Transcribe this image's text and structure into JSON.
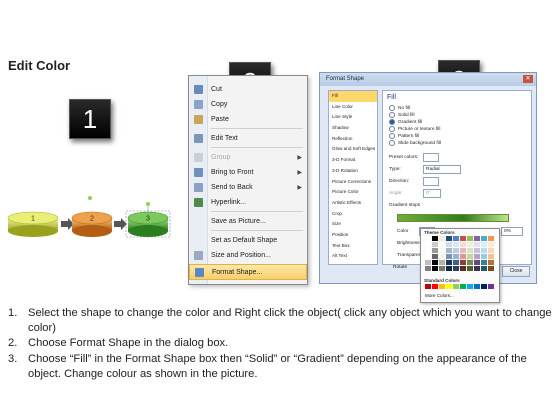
{
  "title": "Edit Color",
  "badges": [
    "1",
    "2",
    "3"
  ],
  "diagram": {
    "shapes": [
      {
        "label": "1",
        "color": "#d6df3a"
      },
      {
        "label": "2",
        "color": "#e0892c"
      },
      {
        "label": "3",
        "color": "#4fae3c"
      }
    ],
    "arrow_color": "#555555"
  },
  "context_menu": {
    "items": [
      {
        "label": "Cut",
        "icon": "scissors-icon",
        "disabled": false,
        "submenu": false
      },
      {
        "label": "Copy",
        "icon": "copy-icon",
        "disabled": false,
        "submenu": false
      },
      {
        "label": "Paste",
        "icon": "paste-icon",
        "disabled": false,
        "submenu": false
      },
      {
        "label": "Edit Text",
        "icon": "edit-text-icon",
        "disabled": false,
        "submenu": false
      },
      {
        "label": "Group",
        "icon": "group-icon",
        "disabled": true,
        "submenu": true
      },
      {
        "label": "Bring to Front",
        "icon": "bring-front-icon",
        "disabled": false,
        "submenu": true
      },
      {
        "label": "Send to Back",
        "icon": "send-back-icon",
        "disabled": false,
        "submenu": true
      },
      {
        "label": "Hyperlink...",
        "icon": "hyperlink-icon",
        "disabled": false,
        "submenu": false
      },
      {
        "label": "Save as Picture...",
        "icon": "",
        "disabled": false,
        "submenu": false
      },
      {
        "label": "Set as Default Shape",
        "icon": "",
        "disabled": false,
        "submenu": false
      },
      {
        "label": "Size and Position...",
        "icon": "size-icon",
        "disabled": false,
        "submenu": false
      },
      {
        "label": "Format Shape...",
        "icon": "format-shape-icon",
        "disabled": false,
        "submenu": false,
        "highlighted": true
      }
    ]
  },
  "dialog": {
    "title": "Format Shape",
    "nav": [
      "Fill",
      "Line Color",
      "Line Style",
      "Shadow",
      "Reflection",
      "Glow and Soft Edges",
      "3-D Format",
      "3-D Rotation",
      "Picture Corrections",
      "Picture Color",
      "Artistic Effects",
      "Crop",
      "Size",
      "Position",
      "Text Box",
      "Alt Text"
    ],
    "section_title": "Fill",
    "fill_options": [
      {
        "label": "No fill",
        "selected": false
      },
      {
        "label": "Solid fill",
        "selected": false
      },
      {
        "label": "Gradient fill",
        "selected": true
      },
      {
        "label": "Picture or texture fill",
        "selected": false
      },
      {
        "label": "Pattern fill",
        "selected": false
      },
      {
        "label": "Slide background fill",
        "selected": false
      }
    ],
    "preset_colors_label": "Preset colors:",
    "type_label": "Type:",
    "type_value": "Radial",
    "direction_label": "Direction:",
    "angle_label": "Angle:",
    "angle_value": "0°",
    "gradient_stops_label": "Gradient stops",
    "color_label": "Color",
    "position_label": "Position:",
    "position_value": "0%",
    "brightness_label": "Brightness:",
    "transparency_label": "Transparen",
    "rotate_label": "Rotate",
    "close_label": "Close",
    "color_popup": {
      "theme_header": "Theme Colors",
      "standard_header": "Standard Colors",
      "more_label": "More Colors...",
      "theme_top": [
        "#ffffff",
        "#000000",
        "#eeece1",
        "#1f497d",
        "#4f81bd",
        "#c0504d",
        "#9bbb59",
        "#8064a2",
        "#4bacc6",
        "#f79646"
      ],
      "standard": [
        "#c00000",
        "#ff0000",
        "#ffc000",
        "#ffff00",
        "#92d050",
        "#00b050",
        "#00b0f0",
        "#0070c0",
        "#002060",
        "#7030a0"
      ]
    }
  },
  "instructions": [
    {
      "num": "1.",
      "text": "Select the shape to change the color and Right click the object( click any object which you want to change color)"
    },
    {
      "num": "2.",
      "text": "Choose Format Shape in the dialog box."
    },
    {
      "num": "3.",
      "text": "Choose “Fill” in the Format Shape box then “Solid” or “Gradient” depending on the appearance of the object. Change colour as shown in the picture."
    }
  ]
}
